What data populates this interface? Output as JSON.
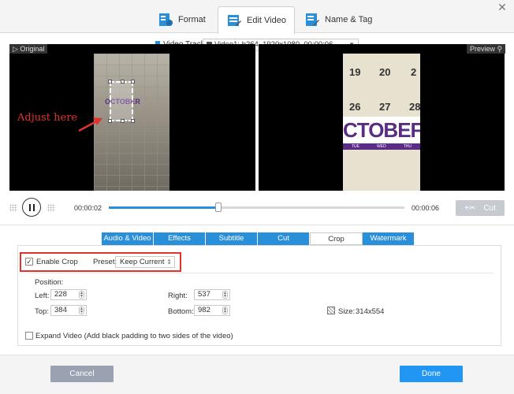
{
  "window": {
    "close_label": "✕"
  },
  "tabs": [
    {
      "label": "Format",
      "icon": "format-icon"
    },
    {
      "label": "Edit Video",
      "icon": "edit-video-icon",
      "active": true
    },
    {
      "label": "Name & Tag",
      "icon": "name-tag-icon"
    }
  ],
  "video_track": {
    "label": "Video Track:",
    "value": "Video1: h264, 1920x1080, 00:00:06"
  },
  "viewers": {
    "original_label": "Original",
    "preview_label": "Preview",
    "annotation": "Adjust here",
    "month_left": "OCTOBER",
    "month_right": "CTOBEF",
    "days": [
      "TUE",
      "WED",
      "THU"
    ],
    "numbers": [
      "19",
      "20",
      "2",
      "26",
      "27",
      "28"
    ]
  },
  "playback": {
    "current_time": "00:00:02",
    "end_time": "00:00:06",
    "progress": 0.37,
    "cut_label": "Cut"
  },
  "subtabs": [
    {
      "label": "Audio & Video"
    },
    {
      "label": "Effects"
    },
    {
      "label": "Subtitle"
    },
    {
      "label": "Cut"
    },
    {
      "label": "Crop",
      "active": true
    },
    {
      "label": "Watermark"
    }
  ],
  "crop": {
    "enable_label": "Enable Crop",
    "enabled": true,
    "preset_label": "Preset:",
    "preset_value": "Keep Current",
    "position_label": "Position:",
    "left_label": "Left:",
    "left_value": "228",
    "top_label": "Top:",
    "top_value": "384",
    "right_label": "Right:",
    "right_value": "537",
    "bottom_label": "Bottom:",
    "bottom_value": "982",
    "size_label": "Size:",
    "size_value": "314x554",
    "expand_label": "Expand Video (Add black padding to two sides of the video)",
    "expand_checked": false
  },
  "footer": {
    "cancel_label": "Cancel",
    "done_label": "Done"
  },
  "colors": {
    "accent": "#2a8fd9",
    "highlight_red": "#e0332d",
    "calendar_purple": "#5b2c83"
  }
}
